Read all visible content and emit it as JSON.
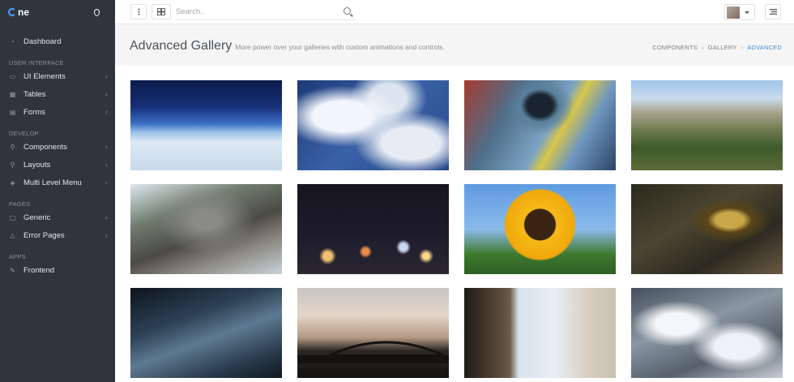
{
  "brand": {
    "name": "ne"
  },
  "sidebar": {
    "items": [
      {
        "type": "item",
        "label": "Dashboard",
        "icon": "dashboard-icon",
        "chevron": false
      },
      {
        "type": "head",
        "label": "USER INTERFACE"
      },
      {
        "type": "item",
        "label": "UI Elements",
        "icon": "briefcase-icon",
        "chevron": true
      },
      {
        "type": "item",
        "label": "Tables",
        "icon": "table-icon",
        "chevron": true
      },
      {
        "type": "item",
        "label": "Forms",
        "icon": "forms-icon",
        "chevron": true
      },
      {
        "type": "head",
        "label": "DEVELOP"
      },
      {
        "type": "item",
        "label": "Components",
        "icon": "wrench-icon",
        "chevron": true
      },
      {
        "type": "item",
        "label": "Layouts",
        "icon": "layout-icon",
        "chevron": true
      },
      {
        "type": "item",
        "label": "Multi Level Menu",
        "icon": "tag-icon",
        "chevron": true
      },
      {
        "type": "head",
        "label": "PAGES"
      },
      {
        "type": "item",
        "label": "Generic",
        "icon": "file-icon",
        "chevron": true
      },
      {
        "type": "item",
        "label": "Error Pages",
        "icon": "warning-icon",
        "chevron": true
      },
      {
        "type": "head",
        "label": "APPS"
      },
      {
        "type": "item",
        "label": "Frontend",
        "icon": "pencil-icon",
        "chevron": false
      }
    ]
  },
  "search": {
    "placeholder": "Search.."
  },
  "header": {
    "title": "Advanced Gallery",
    "subtitle": "More power over your galleries with custom animations and controls."
  },
  "breadcrumb": {
    "items": [
      "COMPONENTS",
      "GALLERY",
      "ADVANCED"
    ]
  },
  "gallery": {
    "images": [
      "space-earth-horizon",
      "clouds-blue-sky",
      "painted-eye",
      "mountain-valley",
      "tree-trunk-upward",
      "city-lights-bokeh",
      "sunflower",
      "lantern-on-tree",
      "wooden-door-closeup",
      "arch-bridge-sunset",
      "tree-bark-beach",
      "snowy-mountains-aerial"
    ]
  }
}
